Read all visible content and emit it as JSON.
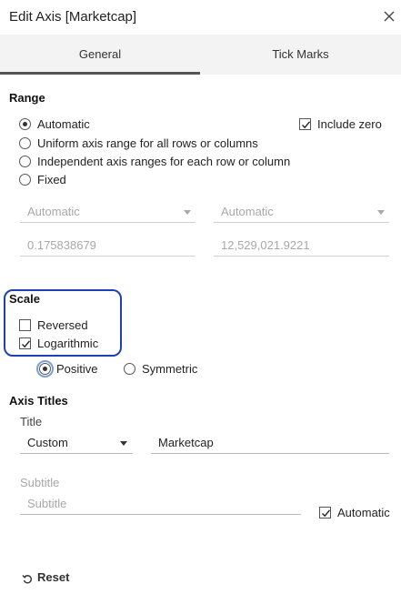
{
  "dialog": {
    "title": "Edit Axis [Marketcap]",
    "close_icon": "close-icon"
  },
  "tabs": [
    {
      "label": "General",
      "selected": true
    },
    {
      "label": "Tick Marks",
      "selected": false
    }
  ],
  "range": {
    "heading": "Range",
    "options": [
      {
        "label": "Automatic",
        "selected": true
      },
      {
        "label": "Uniform axis range for all rows or columns",
        "selected": false
      },
      {
        "label": "Independent axis ranges for each row or column",
        "selected": false
      },
      {
        "label": "Fixed",
        "selected": false
      }
    ],
    "include_zero": {
      "label": "Include zero",
      "checked": true
    },
    "start_dropdown": "Automatic",
    "end_dropdown": "Automatic",
    "start_value": "0.175838679",
    "end_value": "12,529,021.9221"
  },
  "scale": {
    "heading": "Scale",
    "reversed": {
      "label": "Reversed",
      "checked": false
    },
    "logarithmic": {
      "label": "Logarithmic",
      "checked": true
    },
    "positive": {
      "label": "Positive",
      "selected": true
    },
    "symmetric": {
      "label": "Symmetric",
      "selected": false
    }
  },
  "axis_titles": {
    "heading": "Axis Titles",
    "title_label": "Title",
    "title_mode": "Custom",
    "title_value": "Marketcap",
    "subtitle_label": "Subtitle",
    "subtitle_placeholder": "Subtitle",
    "automatic": {
      "label": "Automatic",
      "checked": true
    }
  },
  "footer": {
    "reset_label": "Reset",
    "reset_icon": "reset-icon"
  },
  "colors": {
    "highlight_border": "#1e40b4",
    "tab_bar": "#f3f3f3",
    "tab_indicator": "#555555",
    "disabled_text": "#a8a8a8"
  }
}
